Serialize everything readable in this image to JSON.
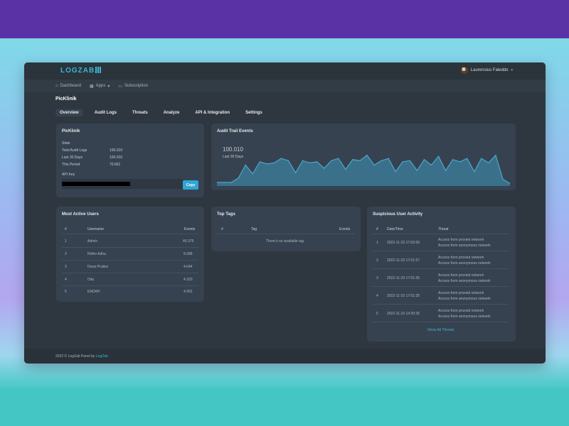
{
  "header": {
    "logo": "LOGZAB",
    "user_name": "Laurensius Faleddo"
  },
  "nav": [
    {
      "label": "Dashboard",
      "icon": "home-icon"
    },
    {
      "label": "Apps",
      "icon": "grid-icon"
    },
    {
      "label": "Subscription",
      "icon": "card-icon"
    }
  ],
  "page_title": "PicKlinik",
  "tabs": [
    "Overview",
    "Audit Logs",
    "Threats",
    "Analyze",
    "API & Integration",
    "Settings"
  ],
  "info_card": {
    "title": "PicKlinik",
    "stats_label": "Stats",
    "stats": [
      {
        "label": "Total Audit Logs",
        "value": "100.010"
      },
      {
        "label": "Last 30 Days",
        "value": "100.010"
      },
      {
        "label": "This Period",
        "value": "70.661"
      }
    ],
    "api_key_label": "API Key",
    "copy_label": "Copy"
  },
  "audit_card": {
    "title": "Audit Trail Events",
    "total": "100.010",
    "period": "Last 30 Days"
  },
  "chart_data": {
    "type": "area",
    "values": [
      2,
      2,
      2,
      6,
      18,
      10,
      21,
      19,
      20,
      24,
      22,
      11,
      22,
      20,
      21,
      15,
      22,
      24,
      14,
      23,
      22,
      27,
      18,
      22,
      24,
      12,
      21,
      22,
      13,
      23,
      18,
      26,
      13,
      23,
      21,
      24,
      12,
      24,
      20,
      27,
      5,
      1
    ]
  },
  "active_users": {
    "title": "Most Active Users",
    "headers": [
      "#",
      "Username",
      "Events"
    ],
    "rows": [
      {
        "n": "1",
        "name": "Admin",
        "events": "40.379"
      },
      {
        "n": "2",
        "name": "Ridho Adha",
        "events": "8.088"
      },
      {
        "n": "3",
        "name": "Dessi Pratiwi",
        "events": "4.644"
      },
      {
        "n": "4",
        "name": "Dita",
        "events": "4.320"
      },
      {
        "n": "5",
        "name": "ENDAH",
        "events": "4.052"
      }
    ]
  },
  "top_tags": {
    "title": "Top Tags",
    "headers": [
      "#",
      "Tag",
      "Events"
    ],
    "empty": "There's no available tag."
  },
  "suspicious": {
    "title": "Suspicious User Activity",
    "headers": [
      "#",
      "Date/Time",
      "Threat"
    ],
    "rows": [
      {
        "n": "1",
        "date": "2022-11-23 17:02:00",
        "t1": "Access from proxied network",
        "t2": "Access from anonymous network"
      },
      {
        "n": "2",
        "date": "2022-11-23 17:01:57",
        "t1": "Access from proxied network",
        "t2": "Access from anonymous network"
      },
      {
        "n": "3",
        "date": "2022-11-23 17:01:35",
        "t1": "Access from proxied network",
        "t2": "Access from anonymous network"
      },
      {
        "n": "4",
        "date": "2022-11-23 17:01:35",
        "t1": "Access from proxied network",
        "t2": "Access from anonymous network"
      },
      {
        "n": "5",
        "date": "2022-11-23 14:30:35",
        "t1": "Access from proxied network",
        "t2": "Access from anonymous network"
      }
    ],
    "show_all": "Show All Threats"
  },
  "footer": {
    "text": "2022 © LogZab Panel by ",
    "link": "LogZab"
  },
  "colors": {
    "accent": "#3bb6d6",
    "panel": "#374250",
    "window": "#2e3740"
  }
}
